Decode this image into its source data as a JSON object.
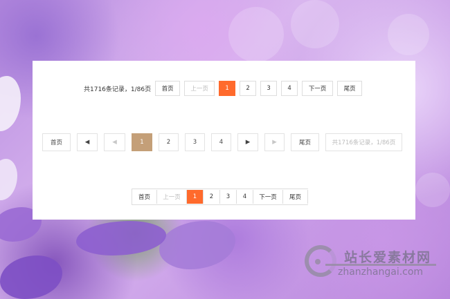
{
  "row1": {
    "summary": "共1716条记录，1/86页",
    "first": "首页",
    "prev": "上一页",
    "pages": [
      "1",
      "2",
      "3",
      "4"
    ],
    "active_page": "1",
    "next": "下一页",
    "last": "尾页"
  },
  "row2": {
    "first": "首页",
    "prev_icon": "◀",
    "prev_disabled_icon": "◀",
    "pages": [
      "1",
      "2",
      "3",
      "4"
    ],
    "active_page": "1",
    "next_icon": "▶",
    "next_disabled_icon": "▶",
    "last": "尾页",
    "summary": "共1716条记录，1/86页"
  },
  "row3": {
    "first": "首页",
    "prev": "上一页",
    "pages": [
      "1",
      "2",
      "3",
      "4"
    ],
    "active_page": "1",
    "next": "下一页",
    "last": "尾页"
  },
  "watermark": {
    "title": "站长爱素材网",
    "url": "zhanzhangai.com"
  },
  "colors": {
    "active_orange": "#ff6a2c",
    "active_tan": "#c49f78",
    "border": "#dddddd"
  }
}
